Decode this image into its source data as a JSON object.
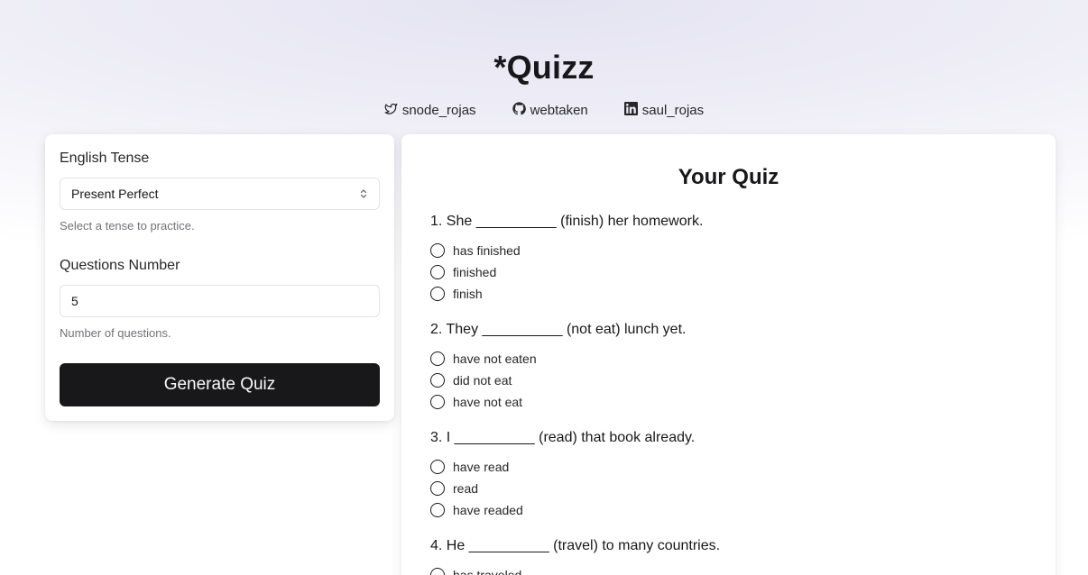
{
  "app": {
    "title": "*Quizz"
  },
  "social": [
    {
      "icon": "twitter-icon",
      "label": "snode_rojas"
    },
    {
      "icon": "github-icon",
      "label": "webtaken"
    },
    {
      "icon": "linkedin-icon",
      "label": "saul_rojas"
    }
  ],
  "form": {
    "tense_label": "English Tense",
    "tense_value": "Present Perfect",
    "tense_help": "Select a tense to practice.",
    "questions_label": "Questions Number",
    "questions_value": "5",
    "questions_help": "Number of questions.",
    "generate_label": "Generate Quiz"
  },
  "quiz": {
    "title": "Your Quiz",
    "questions": [
      {
        "text": "1. She __________ (finish) her homework.",
        "options": [
          "has finished",
          "finished",
          "finish"
        ]
      },
      {
        "text": "2. They __________ (not eat) lunch yet.",
        "options": [
          "have not eaten",
          "did not eat",
          "have not eat"
        ]
      },
      {
        "text": "3. I __________ (read) that book already.",
        "options": [
          "have read",
          "read",
          "have readed"
        ]
      },
      {
        "text": "4. He __________ (travel) to many countries.",
        "options": [
          "has traveled"
        ]
      }
    ]
  }
}
